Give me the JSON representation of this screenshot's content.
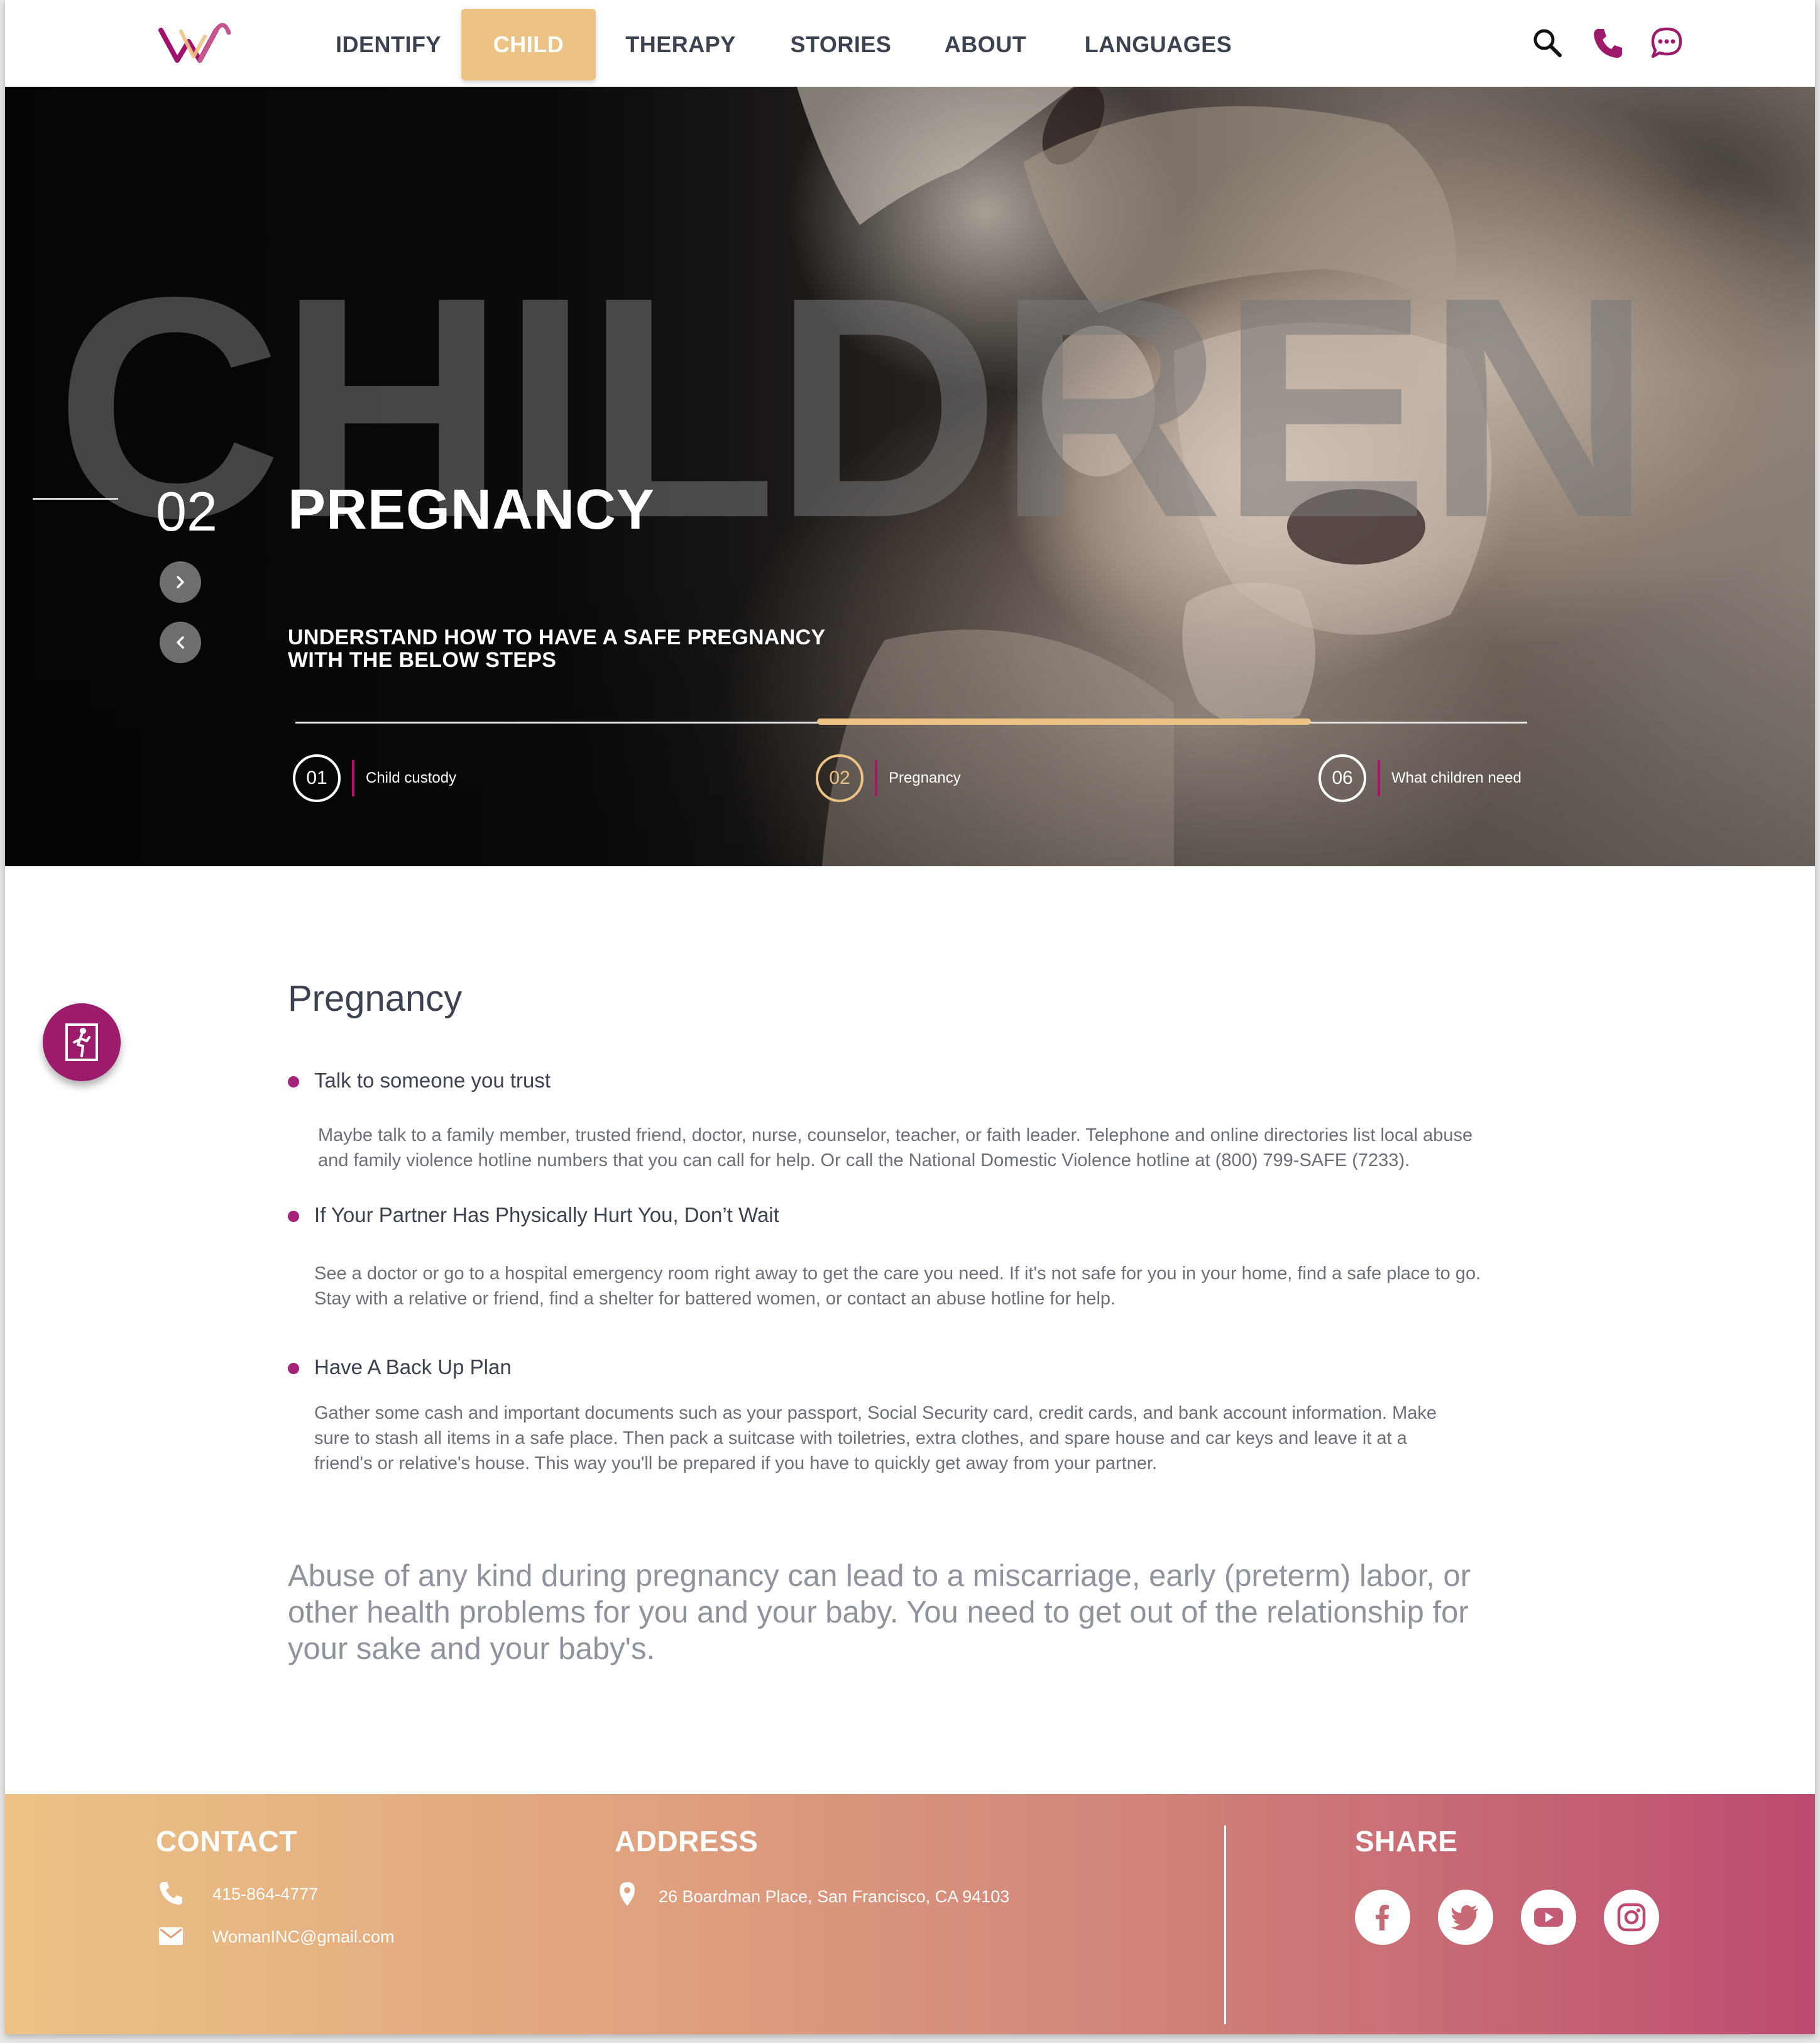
{
  "header": {
    "nav": [
      "IDENTIFY",
      "CHILD",
      "THERAPY",
      "STORIES",
      "ABOUT",
      "LANGUAGES"
    ],
    "active_nav": "CHILD",
    "icons": [
      "search-icon",
      "phone-icon",
      "chat-icon"
    ]
  },
  "hero": {
    "background_word": "CHILDREN",
    "number": "02",
    "title": "PREGNANCY",
    "subtitle_line1": "UNDERSTAND HOW TO HAVE A SAFE PREGNANCY",
    "subtitle_line2": "WITH THE BELOW STEPS",
    "steps": [
      {
        "num": "01",
        "label": "Child custody"
      },
      {
        "num": "02",
        "label": "Pregnancy"
      },
      {
        "num": "06",
        "label": "What children need"
      }
    ],
    "active_step": "02"
  },
  "content": {
    "title": "Pregnancy",
    "items": [
      {
        "title": "Talk to someone you trust",
        "body_line1": "Maybe talk to a family member, trusted friend, doctor, nurse, counselor, teacher, or faith leader. Telephone and online directories list local abuse",
        "body_line2": "and family violence hotline numbers that you can call for help. Or call the National Domestic Violence hotline at (800) 799-SAFE (7233)."
      },
      {
        "title": "If Your Partner Has Physically Hurt You, Don’t Wait",
        "body_line1": "See a doctor or go to a hospital emergency room right away to get the care you need. If it's not safe for you in your home, find a safe place to go.",
        "body_line2": "Stay with a relative or friend, find a shelter for battered women, or contact an abuse hotline for help."
      },
      {
        "title": "Have A Back Up Plan",
        "body_line1": "Gather some cash and important documents such as your passport, Social Security card, credit cards, and bank account information. Make",
        "body_line2": "sure to stash all items in a safe place. Then pack a suitcase with toiletries, extra clothes, and spare house and car keys and leave it at a",
        "body_line3": "friend's or relative's house. This way you'll be prepared if you have to quickly get away from your partner."
      }
    ],
    "quote_line1": "Abuse of any kind during pregnancy can lead to a miscarriage, early (preterm) labor, or",
    "quote_line2": "other health problems for you and your baby. You need to get out of the relationship for",
    "quote_line3": "your sake and your baby's."
  },
  "footer": {
    "contact_heading": "CONTACT",
    "phone": "415-864-4777",
    "email": "WomanINC@gmail.com",
    "address_heading": "ADDRESS",
    "address": "26 Boardman Place, San Francisco, CA 94103",
    "share_heading": "SHARE",
    "social": [
      "facebook-icon",
      "twitter-icon",
      "youtube-icon",
      "instagram-icon"
    ]
  },
  "colors": {
    "accent": "#ecc385",
    "brand": "#9c1b6b",
    "text": "#3d4250"
  }
}
